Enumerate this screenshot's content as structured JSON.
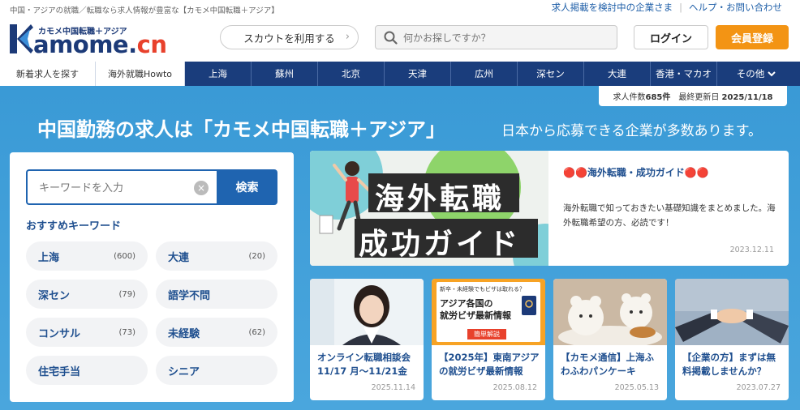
{
  "header": {
    "tagline": "中国・アジアの就職／転職なら求人情報が豊富な【カモメ中国転職＋アジア】",
    "links": [
      "求人掲載を検討中の企業さま",
      "ヘルプ・お問い合わせ"
    ],
    "logo_sub": "カモメ中国転職＋アジア",
    "logo_main": "amome.",
    "logo_cn": "cn",
    "scout_label": "スカウトを利用する",
    "search_placeholder": "何かお探しですか？",
    "login_label": "ログイン",
    "register_label": "会員登録"
  },
  "nav": {
    "tabs": [
      "新着求人を探す",
      "海外就職Howto"
    ],
    "cities": [
      "上海",
      "蘇州",
      "北京",
      "天津",
      "広州",
      "深セン",
      "大連",
      "香港・マカオ"
    ],
    "more_label": "その他"
  },
  "stats": {
    "count_label": "求人件数",
    "count_value": "685件",
    "updated_label": "最終更新日",
    "updated_value": "2025/11/18"
  },
  "hero": {
    "title": "中国勤務の求人は「カモメ中国転職＋アジア」",
    "subtitle": "日本から応募できる企業が多数あります。"
  },
  "search": {
    "placeholder": "キーワードを入力",
    "button_label": "検索",
    "recommended_heading": "おすすめキーワード",
    "keywords": [
      {
        "label": "上海",
        "count": "(600)"
      },
      {
        "label": "大連",
        "count": "(20)"
      },
      {
        "label": "深セン",
        "count": "(79)"
      },
      {
        "label": "語学不問",
        "count": ""
      },
      {
        "label": "コンサル",
        "count": "(73)"
      },
      {
        "label": "未経験",
        "count": "(62)"
      },
      {
        "label": "住宅手当",
        "count": ""
      },
      {
        "label": "シニア",
        "count": ""
      }
    ]
  },
  "banner": {
    "image_line1": "海外転職",
    "image_line2": "成功ガイド",
    "title": "🔴🔴海外転職・成功ガイド🔴🔴",
    "description": "海外転職で知っておきたい基礎知識をまとめました。海外転職希望の方、必読です！",
    "date": "2023.12.11"
  },
  "articles": [
    {
      "title": "オンライン転職相談会 11/17 月～11/21金",
      "date": "2025.11.14",
      "image": "woman-portrait"
    },
    {
      "title": "【2025年】東南アジアの就労ビザ最新情報",
      "date": "2025.08.12",
      "image": "visa-info",
      "image_top": "新卒・未経験でもビザは取れる？",
      "image_main1": "アジア各国の",
      "image_main2": "就労ビザ最新情報",
      "image_bottom": "簡単解説"
    },
    {
      "title": "【カモメ通信】上海ふわふわパンケーキ",
      "date": "2025.05.13",
      "image": "pancake-bear"
    },
    {
      "title": "【企業の方】まずは無料掲載しませんか？",
      "date": "2023.07.27",
      "image": "handshake"
    }
  ],
  "colors": {
    "navy": "#1a3d7c",
    "hero_blue": "#3a9ad6",
    "orange": "#f39414",
    "link_blue": "#1f4f8f"
  }
}
